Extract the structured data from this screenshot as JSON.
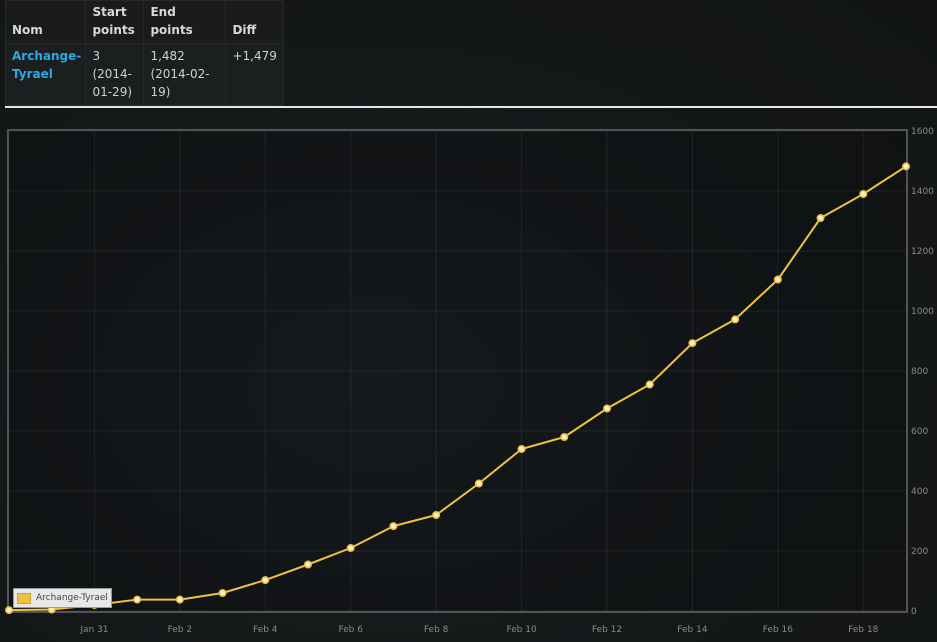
{
  "table": {
    "headers": {
      "name": "Nom",
      "start": "Start points",
      "end": "End points",
      "diff": "Diff"
    },
    "rows": [
      {
        "name": "Archange-Tyrael",
        "start": "3 (2014-01-29)",
        "end": "1,482 (2014-02-19)",
        "diff": "+1,479"
      }
    ]
  },
  "colors": {
    "series": "#edc240",
    "link": "#29a9e6",
    "diff_positive": "#3fae3f"
  },
  "chart_data": {
    "type": "line",
    "title": "",
    "xlabel": "",
    "ylabel": "",
    "x_ticks": [
      "Jan 31",
      "Feb 2",
      "Feb 4",
      "Feb 6",
      "Feb 8",
      "Feb 10",
      "Feb 12",
      "Feb 14",
      "Feb 16",
      "Feb 18"
    ],
    "y_ticks": [
      "0",
      "200",
      "400",
      "600",
      "800",
      "1000",
      "1200",
      "1400",
      "1600"
    ],
    "xlim": [
      "2014-01-29",
      "2014-02-19"
    ],
    "ylim": [
      0,
      1600
    ],
    "grid": true,
    "legend": "bottom-left",
    "series": [
      {
        "name": "Archange-Tyrael",
        "x": [
          "2014-01-29",
          "2014-01-30",
          "2014-01-31",
          "2014-02-01",
          "2014-02-02",
          "2014-02-03",
          "2014-02-04",
          "2014-02-05",
          "2014-02-06",
          "2014-02-07",
          "2014-02-08",
          "2014-02-09",
          "2014-02-10",
          "2014-02-11",
          "2014-02-12",
          "2014-02-13",
          "2014-02-14",
          "2014-02-15",
          "2014-02-16",
          "2014-02-17",
          "2014-02-18",
          "2014-02-19"
        ],
        "values": [
          3,
          5,
          20,
          38,
          38,
          60,
          103,
          155,
          210,
          283,
          320,
          425,
          540,
          580,
          675,
          755,
          893,
          972,
          1105,
          1310,
          1390,
          1482
        ]
      }
    ]
  }
}
